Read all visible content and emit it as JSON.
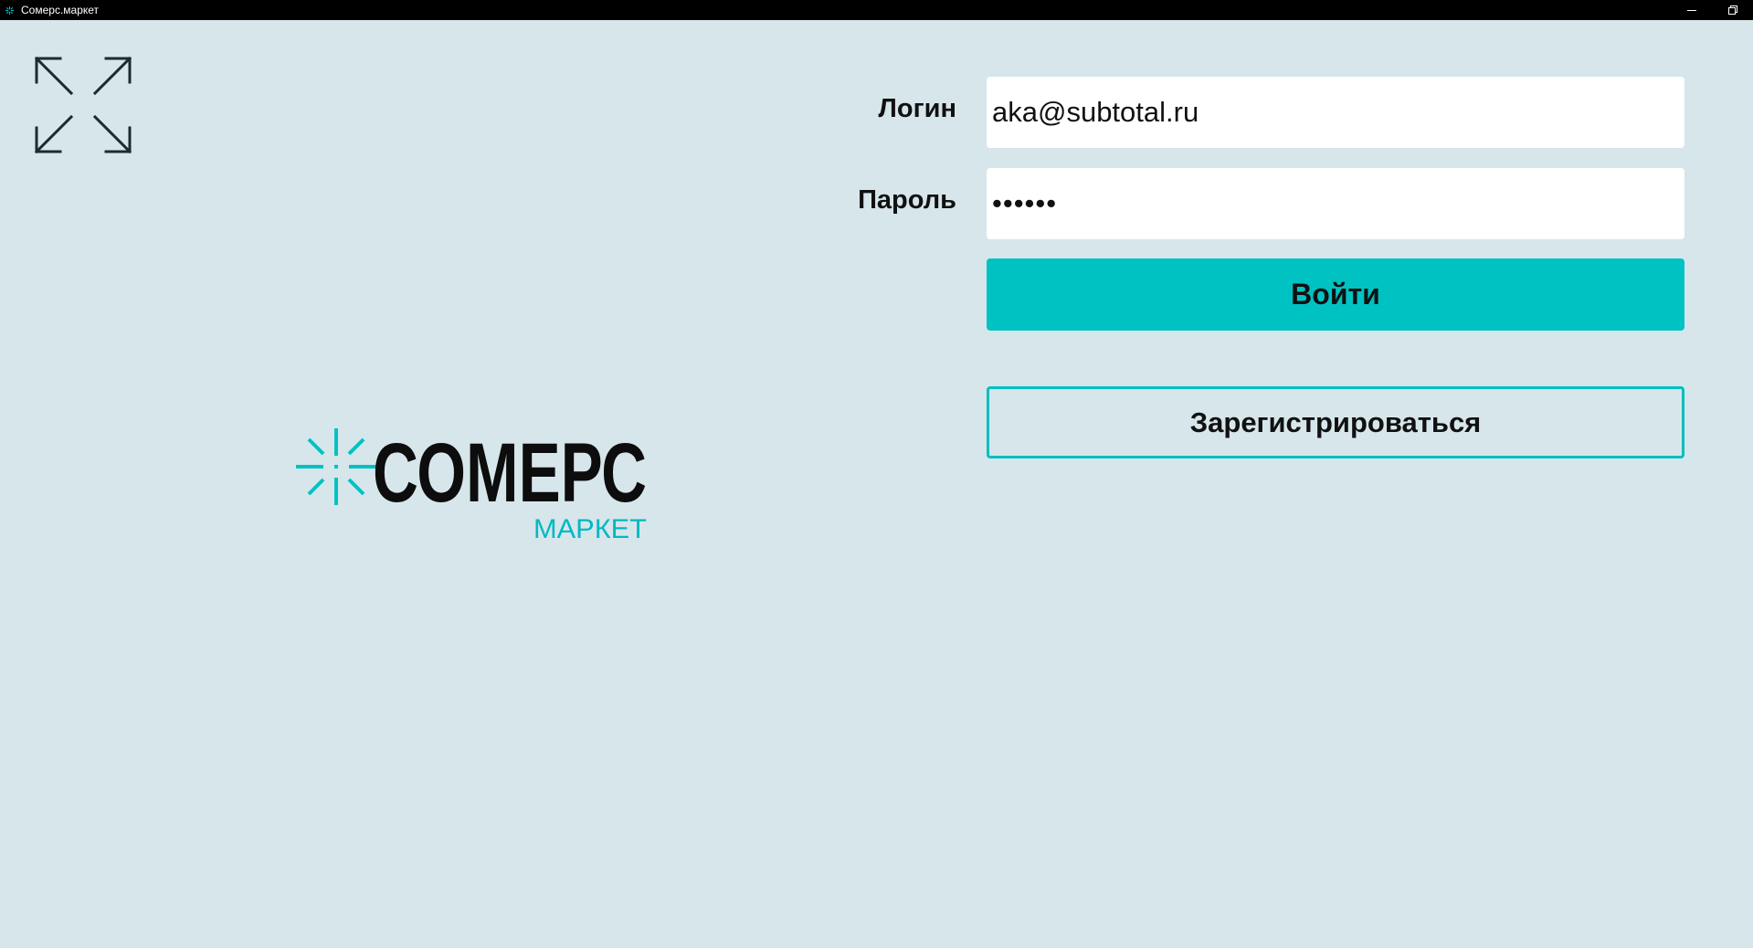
{
  "window": {
    "title": "Сомерс.маркет",
    "app_icon": "sparkle-icon",
    "controls": [
      "minimize-icon",
      "restore-icon"
    ]
  },
  "toolbar": {
    "fullscreen_icon": "expand-arrows-icon"
  },
  "logo": {
    "brand_name": "СОМЕРС",
    "brand_subtitle": "МАРКЕТ",
    "icon": "sparkle-icon"
  },
  "form": {
    "login_label": "Логин",
    "login_value": "aka@subtotal.ru",
    "password_label": "Пароль",
    "password_value": "••••••",
    "submit_label": "Войти",
    "register_label": "Зарегистрироваться"
  },
  "colors": {
    "background": "#d7e6eb",
    "accent": "#00c2c3",
    "text": "#111111",
    "titlebar": "#000000"
  }
}
